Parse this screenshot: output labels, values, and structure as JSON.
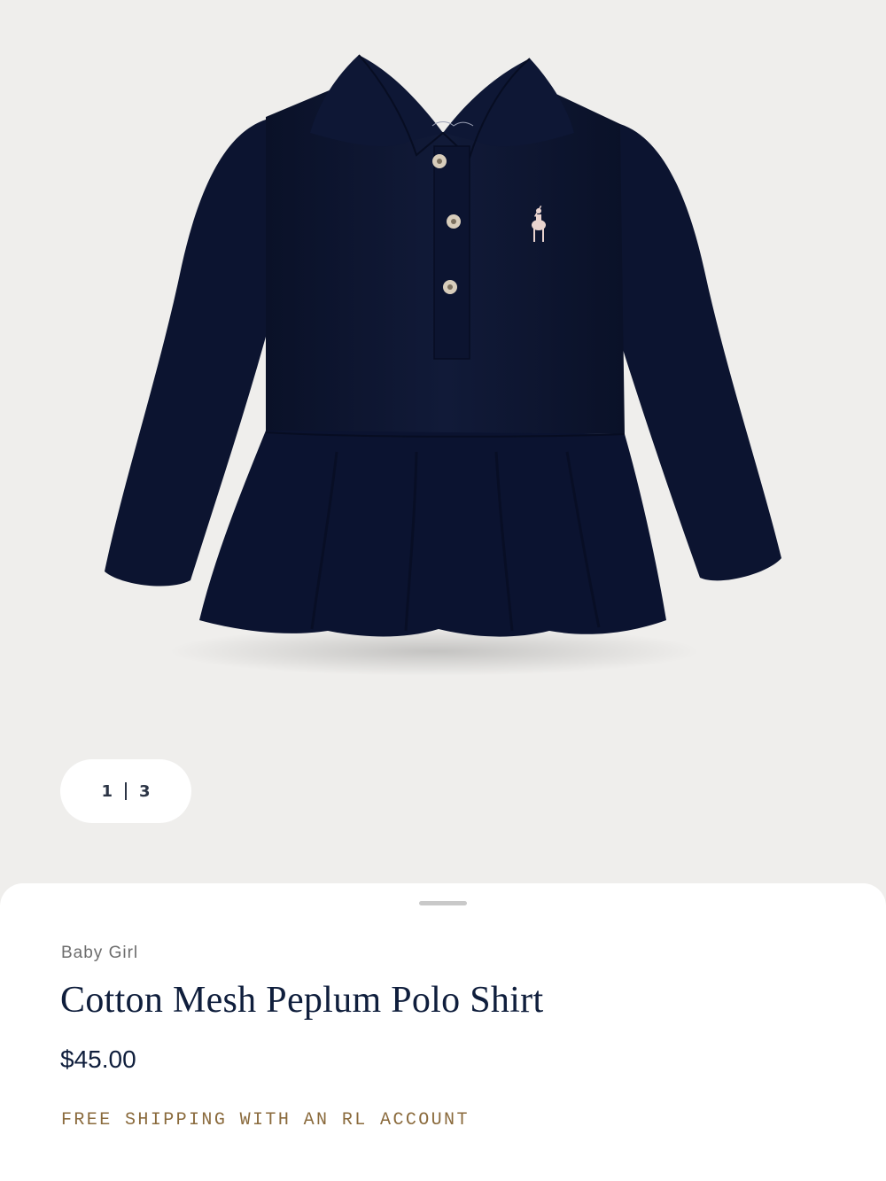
{
  "gallery": {
    "current_index": "1",
    "total_count": "3",
    "image_alt": "Cotton Mesh Peplum Polo Shirt",
    "garment_color": "#0d1530"
  },
  "product": {
    "category": "Baby Girl",
    "title": "Cotton Mesh Peplum Polo Shirt",
    "price": "$45.00",
    "shipping_note": "FREE SHIPPING WITH AN RL ACCOUNT"
  },
  "colors": {
    "background": "#efeeec",
    "sheet": "#ffffff",
    "navy_text": "#0f1e3c",
    "muted_text": "#6d6d6d",
    "accent_gold": "#8a6a3c"
  }
}
